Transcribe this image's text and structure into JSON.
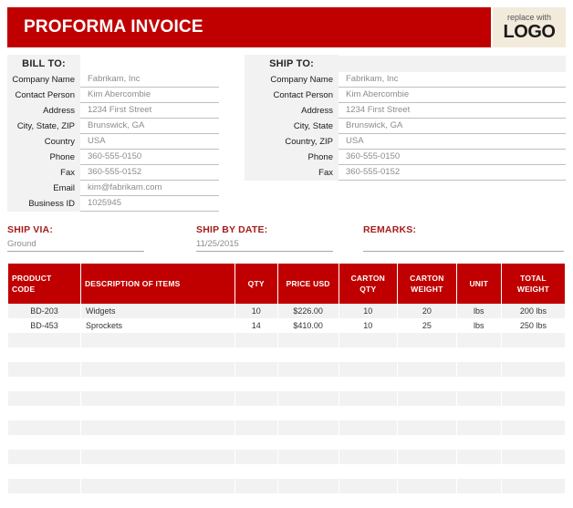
{
  "header": {
    "title": "PROFORMA INVOICE",
    "logo_small": "replace with",
    "logo_big": "LOGO",
    "banner_color": "#C00000"
  },
  "bill_to": {
    "heading": "BILL TO:",
    "fields": [
      {
        "label": "Company Name",
        "value": "Fabrikam, Inc"
      },
      {
        "label": "Contact Person",
        "value": "Kim Abercombie"
      },
      {
        "label": "Address",
        "value": "1234 First Street"
      },
      {
        "label": "City, State, ZIP",
        "value": "Brunswick, GA"
      },
      {
        "label": "Country",
        "value": "USA"
      },
      {
        "label": "Phone",
        "value": "360-555-0150"
      },
      {
        "label": "Fax",
        "value": "360-555-0152"
      },
      {
        "label": "Email",
        "value": "kim@fabrikam.com"
      },
      {
        "label": "Business ID",
        "value": "1025945"
      }
    ]
  },
  "ship_to": {
    "heading": "SHIP TO:",
    "fields": [
      {
        "label": "Company Name",
        "value": "Fabrikam, Inc"
      },
      {
        "label": "Contact Person",
        "value": "Kim Abercombie"
      },
      {
        "label": "Address",
        "value": "1234 First Street"
      },
      {
        "label": "City, State",
        "value": "Brunswick, GA"
      },
      {
        "label": "Country, ZIP",
        "value": "USA"
      },
      {
        "label": "Phone",
        "value": "360-555-0150"
      },
      {
        "label": "Fax",
        "value": "360-555-0152"
      }
    ]
  },
  "shipping": {
    "ship_via_label": "SHIP VIA:",
    "ship_via_value": "Ground",
    "ship_by_date_label": "SHIP BY DATE:",
    "ship_by_date_value": "11/25/2015",
    "remarks_label": "REMARKS:",
    "remarks_value": ""
  },
  "items_table": {
    "columns": [
      "PRODUCT CODE",
      "DESCRIPTION OF ITEMS",
      "QTY",
      "PRICE USD",
      "CARTON QTY",
      "CARTON WEIGHT",
      "UNIT",
      "TOTAL WEIGHT"
    ],
    "column_lines": [
      [
        "PRODUCT",
        "CODE"
      ],
      [
        "DESCRIPTION OF ITEMS"
      ],
      [
        "QTY"
      ],
      [
        "PRICE USD"
      ],
      [
        "CARTON",
        "QTY"
      ],
      [
        "CARTON",
        "WEIGHT"
      ],
      [
        "UNIT"
      ],
      [
        "TOTAL",
        "WEIGHT"
      ]
    ],
    "rows": [
      {
        "product_code": "BD-203",
        "description": "Widgets",
        "qty": "10",
        "price_usd": "$226.00",
        "carton_qty": "10",
        "carton_weight": "20",
        "unit": "lbs",
        "total_weight": "200 lbs"
      },
      {
        "product_code": "BD-453",
        "description": "Sprockets",
        "qty": "14",
        "price_usd": "$410.00",
        "carton_qty": "10",
        "carton_weight": "25",
        "unit": "lbs",
        "total_weight": "250 lbs"
      }
    ],
    "empty_row_count": 12
  }
}
